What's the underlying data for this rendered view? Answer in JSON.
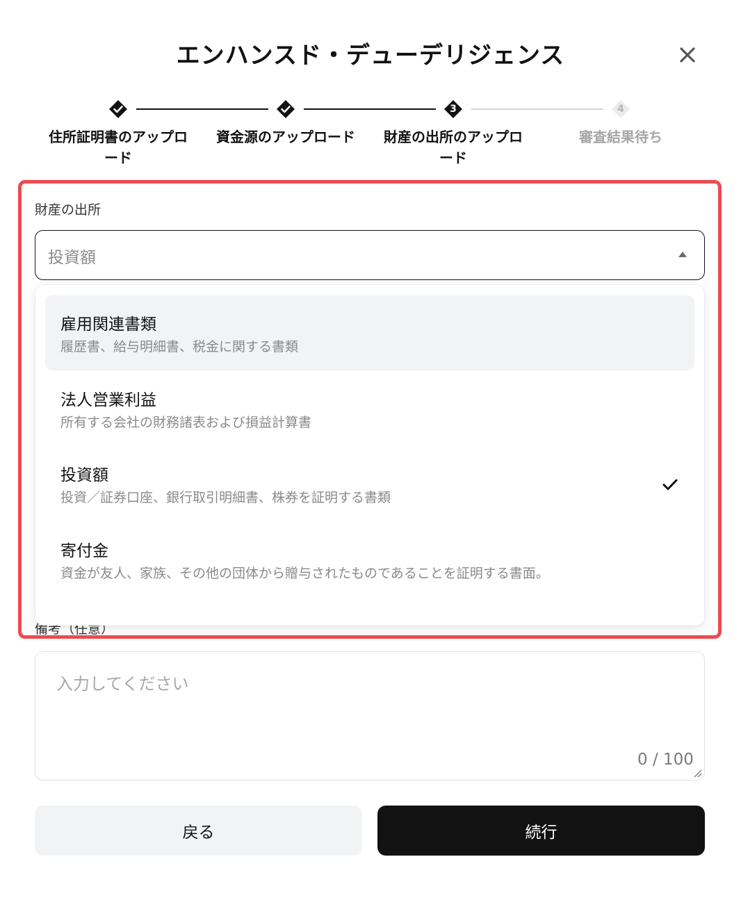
{
  "modal": {
    "title": "エンハンスド・デューデリジェンス"
  },
  "stepper": {
    "steps": [
      {
        "label": "住所証明書のアップロード",
        "status": "completed"
      },
      {
        "label": "資金源のアップロード",
        "status": "completed"
      },
      {
        "label": "財産の出所のアップロード",
        "number": "3",
        "status": "current"
      },
      {
        "label": "審査結果待ち",
        "number": "4",
        "status": "pending"
      }
    ]
  },
  "wealth_source": {
    "label": "財産の出所",
    "selected_value": "投資額",
    "options": [
      {
        "title": "雇用関連書類",
        "description": "履歴書、給与明細書、税金に関する書類",
        "highlighted": true,
        "selected": false
      },
      {
        "title": "法人営業利益",
        "description": "所有する会社の財務諸表および損益計算書",
        "highlighted": false,
        "selected": false
      },
      {
        "title": "投資額",
        "description": "投資／証券口座、銀行取引明細書、株券を証明する書類",
        "highlighted": false,
        "selected": true
      },
      {
        "title": "寄付金",
        "description": "資金が友人、家族、その他の団体から贈与されたものであることを証明する書面。",
        "highlighted": false,
        "selected": false
      }
    ]
  },
  "notes": {
    "label": "備考（任意）",
    "placeholder": "入力してください",
    "counter": "0 / 100"
  },
  "buttons": {
    "back": "戻る",
    "continue": "続行"
  },
  "colors": {
    "primary": "#121212",
    "highlight_frame": "#ec4b50",
    "option_highlight": "#f2f3f5",
    "inactive": "#a6a6a6"
  }
}
